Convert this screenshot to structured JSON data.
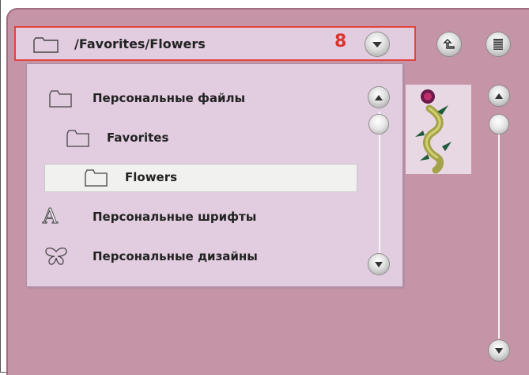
{
  "path_bar": {
    "path": "/Favorites/Flowers",
    "callout_number": "8",
    "icon": "folder-icon",
    "dropdown_icon": "chevron-down-icon"
  },
  "toolbar": {
    "up_icon": "folder-up-icon",
    "list_view_icon": "list-view-icon"
  },
  "dropdown": {
    "items": [
      {
        "label": "Персональные файлы",
        "icon": "folder-icon"
      },
      {
        "label": "Favorites",
        "icon": "folder-icon"
      },
      {
        "label": "Flowers",
        "icon": "folder-icon",
        "selected": true
      },
      {
        "label": "Персональные шрифты",
        "icon": "font-icon"
      },
      {
        "label": "Персональные дизайны",
        "icon": "butterfly-icon"
      }
    ]
  },
  "preview": {
    "design": "flower-stem-design"
  },
  "colors": {
    "panel": "#c594a6",
    "dropdown_bg": "#e2cde0",
    "callout": "#e2443c",
    "selected_row": "#f1f1ef"
  }
}
